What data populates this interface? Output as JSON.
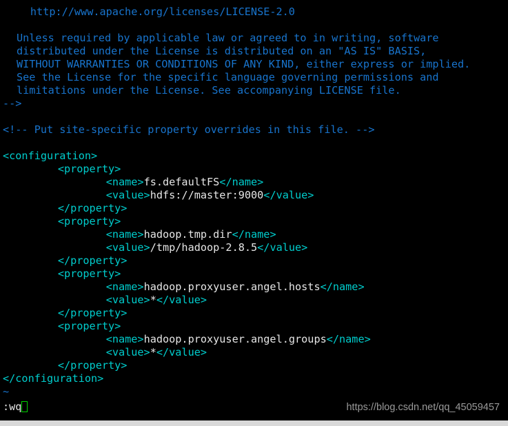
{
  "terminal": {
    "mode": "command",
    "colors": {
      "background": "#000000",
      "comment": "#1874cd",
      "tag": "#00cdcd",
      "text": "#e6e6e6",
      "nontext": "#1874cd",
      "cursor_border": "#00d000",
      "watermark": "#9a9a9a",
      "bottom_bar": "#d9d9d9"
    },
    "lines": [
      {
        "indent": 4,
        "segments": [
          {
            "class": "c-comment",
            "text": "http://www.apache.org/licenses/LICENSE-2.0"
          }
        ]
      },
      {
        "indent": 0,
        "segments": [
          {
            "class": "c-comment",
            "text": ""
          }
        ]
      },
      {
        "indent": 2,
        "segments": [
          {
            "class": "c-comment",
            "text": "Unless required by applicable law or agreed to in writing, software"
          }
        ]
      },
      {
        "indent": 2,
        "segments": [
          {
            "class": "c-comment",
            "text": "distributed under the License is distributed on an \"AS IS\" BASIS,"
          }
        ]
      },
      {
        "indent": 2,
        "segments": [
          {
            "class": "c-comment",
            "text": "WITHOUT WARRANTIES OR CONDITIONS OF ANY KIND, either express or implied."
          }
        ]
      },
      {
        "indent": 2,
        "segments": [
          {
            "class": "c-comment",
            "text": "See the License for the specific language governing permissions and"
          }
        ]
      },
      {
        "indent": 2,
        "segments": [
          {
            "class": "c-comment",
            "text": "limitations under the License. See accompanying LICENSE file."
          }
        ]
      },
      {
        "indent": 0,
        "segments": [
          {
            "class": "c-comment",
            "text": "-->"
          }
        ]
      },
      {
        "indent": 0,
        "segments": [
          {
            "class": "c-text",
            "text": ""
          }
        ]
      },
      {
        "indent": 0,
        "segments": [
          {
            "class": "c-comment",
            "text": "<!-- Put site-specific property overrides in this file. -->"
          }
        ]
      },
      {
        "indent": 0,
        "segments": [
          {
            "class": "c-text",
            "text": ""
          }
        ]
      },
      {
        "indent": 0,
        "segments": [
          {
            "class": "c-tag",
            "text": "<configuration>"
          }
        ]
      },
      {
        "indent": 8,
        "segments": [
          {
            "class": "c-tag",
            "text": "<property>"
          }
        ]
      },
      {
        "indent": 15,
        "segments": [
          {
            "class": "c-tag",
            "text": "<name>"
          },
          {
            "class": "c-text",
            "text": "fs.defaultFS"
          },
          {
            "class": "c-tag",
            "text": "</name>"
          }
        ]
      },
      {
        "indent": 15,
        "segments": [
          {
            "class": "c-tag",
            "text": "<value>"
          },
          {
            "class": "c-text",
            "text": "hdfs://master:9000"
          },
          {
            "class": "c-tag",
            "text": "</value>"
          }
        ]
      },
      {
        "indent": 8,
        "segments": [
          {
            "class": "c-tag",
            "text": "</property>"
          }
        ]
      },
      {
        "indent": 8,
        "segments": [
          {
            "class": "c-tag",
            "text": "<property>"
          }
        ]
      },
      {
        "indent": 15,
        "segments": [
          {
            "class": "c-tag",
            "text": "<name>"
          },
          {
            "class": "c-text",
            "text": "hadoop.tmp.dir"
          },
          {
            "class": "c-tag",
            "text": "</name>"
          }
        ]
      },
      {
        "indent": 15,
        "segments": [
          {
            "class": "c-tag",
            "text": "<value>"
          },
          {
            "class": "c-text",
            "text": "/tmp/hadoop-2.8.5"
          },
          {
            "class": "c-tag",
            "text": "</value>"
          }
        ]
      },
      {
        "indent": 8,
        "segments": [
          {
            "class": "c-tag",
            "text": "</property>"
          }
        ]
      },
      {
        "indent": 8,
        "segments": [
          {
            "class": "c-tag",
            "text": "<property>"
          }
        ]
      },
      {
        "indent": 15,
        "segments": [
          {
            "class": "c-tag",
            "text": "<name>"
          },
          {
            "class": "c-text",
            "text": "hadoop.proxyuser.angel.hosts"
          },
          {
            "class": "c-tag",
            "text": "</name>"
          }
        ]
      },
      {
        "indent": 15,
        "segments": [
          {
            "class": "c-tag",
            "text": "<value>"
          },
          {
            "class": "c-text",
            "text": "*"
          },
          {
            "class": "c-tag",
            "text": "</value>"
          }
        ]
      },
      {
        "indent": 8,
        "segments": [
          {
            "class": "c-tag",
            "text": "</property>"
          }
        ]
      },
      {
        "indent": 8,
        "segments": [
          {
            "class": "c-tag",
            "text": "<property>"
          }
        ]
      },
      {
        "indent": 15,
        "segments": [
          {
            "class": "c-tag",
            "text": "<name>"
          },
          {
            "class": "c-text",
            "text": "hadoop.proxyuser.angel.groups"
          },
          {
            "class": "c-tag",
            "text": "</name>"
          }
        ]
      },
      {
        "indent": 15,
        "segments": [
          {
            "class": "c-tag",
            "text": "<value>"
          },
          {
            "class": "c-text",
            "text": "*"
          },
          {
            "class": "c-tag",
            "text": "</value>"
          }
        ]
      },
      {
        "indent": 8,
        "segments": [
          {
            "class": "c-tag",
            "text": "</property>"
          }
        ]
      },
      {
        "indent": 0,
        "segments": [
          {
            "class": "c-tag",
            "text": "</configuration>"
          }
        ]
      },
      {
        "indent": 0,
        "segments": [
          {
            "class": "c-nontext",
            "text": "~"
          }
        ]
      }
    ],
    "command_line": {
      "text": ":wq",
      "cursor": true
    },
    "watermark": "https://blog.csdn.net/qq_45059457"
  }
}
